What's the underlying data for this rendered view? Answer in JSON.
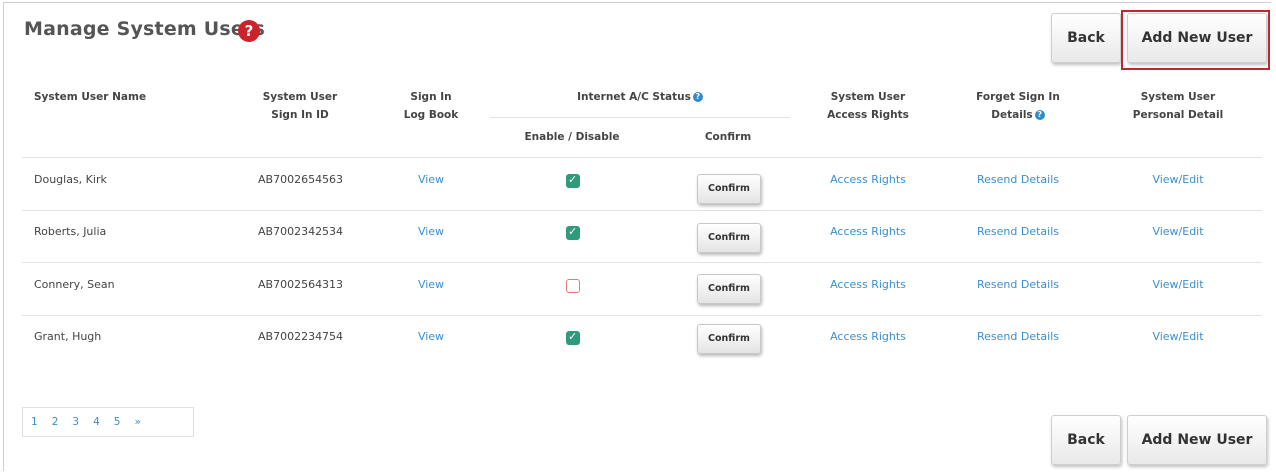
{
  "page": {
    "title": "Manage System Users",
    "help_icon": "question-circle-icon",
    "help_icon_color": "#cc2229"
  },
  "actions": {
    "back_label": "Back",
    "add_new_user_label": "Add New User"
  },
  "table": {
    "headers": {
      "name": "System User Name",
      "signin_id_line1": "System User",
      "signin_id_line2": "Sign In ID",
      "logbook_line1": "Sign In",
      "logbook_line2": "Log Book",
      "internet_status": "Internet A/C Status",
      "enable_disable": "Enable / Disable",
      "confirm": "Confirm",
      "access_line1": "System User",
      "access_line2": "Access Rights",
      "forget_line1": "Forget Sign In",
      "forget_line2": "Details",
      "personal_line1": "System User",
      "personal_line2": "Personal Detail"
    },
    "rows": [
      {
        "name": "Douglas, Kirk",
        "signin_id": "AB7002654563",
        "logbook": "View",
        "enabled": true,
        "confirm": "Confirm",
        "access": "Access Rights",
        "forget": "Resend Details",
        "personal": "View/Edit"
      },
      {
        "name": "Roberts, Julia",
        "signin_id": "AB7002342534",
        "logbook": "View",
        "enabled": true,
        "confirm": "Confirm",
        "access": "Access Rights",
        "forget": "Resend Details",
        "personal": "View/Edit"
      },
      {
        "name": "Connery, Sean",
        "signin_id": "AB7002564313",
        "logbook": "View",
        "enabled": false,
        "confirm": "Confirm",
        "access": "Access Rights",
        "forget": "Resend Details",
        "personal": "View/Edit"
      },
      {
        "name": "Grant, Hugh",
        "signin_id": "AB7002234754",
        "logbook": "View",
        "enabled": true,
        "confirm": "Confirm",
        "access": "Access Rights",
        "forget": "Resend Details",
        "personal": "View/Edit"
      }
    ]
  },
  "pagination": {
    "pages": [
      "1",
      "2",
      "3",
      "4",
      "5"
    ],
    "next": "»"
  },
  "colors": {
    "link": "#3a8fd0",
    "checkbox_on": "#2d9b7c",
    "checkbox_off_border": "#e07c7c",
    "highlight": "#c0282f",
    "info_icon": "#2e8bcc"
  }
}
